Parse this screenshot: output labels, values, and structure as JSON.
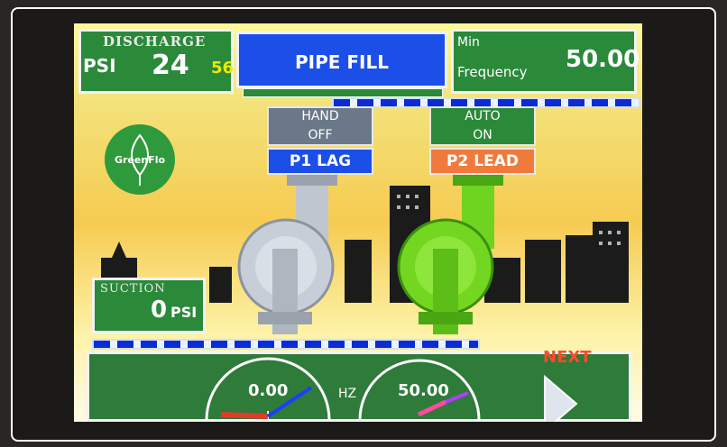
{
  "discharge": {
    "title": "DISCHARGE",
    "unit": "PSI",
    "value": "24",
    "setpoint": "56"
  },
  "mode": {
    "label": "PIPE FILL"
  },
  "min_frequency": {
    "line1": "Min",
    "line2": "Frequency",
    "value": "50.00"
  },
  "logo": {
    "text": "GreenFlo"
  },
  "pump1": {
    "state_line1": "HAND",
    "state_line2": "OFF",
    "role": "P1 LAG"
  },
  "pump2": {
    "state_line1": "AUTO",
    "state_line2": "ON",
    "role": "P2 LEAD"
  },
  "suction": {
    "title": "SUCTION",
    "value": "0",
    "unit": "PSI"
  },
  "gauges": {
    "left_value": "0.00",
    "unit": "HZ",
    "right_value": "50.00"
  },
  "nav": {
    "next_label": "NEXT"
  },
  "colors": {
    "panel_green": "#2a8a3a",
    "pipe_fill_blue": "#1c4fe8",
    "p2_lead_orange": "#f07a3c",
    "next_orange": "#ff4a2a"
  }
}
